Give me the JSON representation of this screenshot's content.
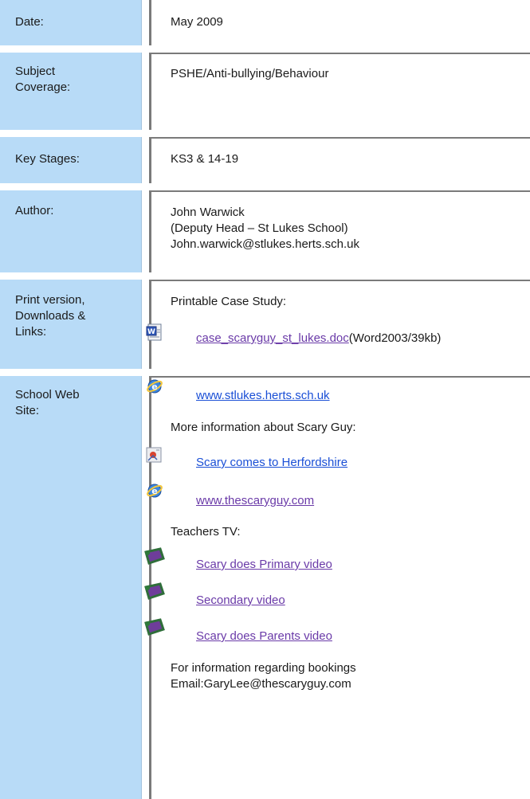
{
  "rows": {
    "date": {
      "label": "Date:",
      "value": "May 2009"
    },
    "subject": {
      "label": "Subject\nCoverage:",
      "value": "PSHE/Anti-bullying/Behaviour"
    },
    "key_stages": {
      "label": "Key Stages:",
      "value": "KS3 & 14-19"
    },
    "author": {
      "label": "Author:",
      "lines": "John Warwick\n(Deputy Head – St Lukes School)\nJohn.warwick@stlukes.herts.sch.uk"
    },
    "print": {
      "label": "Print version,\nDownloads &\nLinks:",
      "heading": "Printable Case Study:",
      "doc_link": "case_scaryguy_st_lukes.doc",
      "doc_meta": "(Word2003/39kb)",
      "doc_icon": "word-document-icon"
    },
    "website": {
      "label": "School Web\nSite:",
      "school_link": "www.stlukes.herts.sch.uk",
      "more_info": "More information about Scary Guy:",
      "scary_herts": "Scary comes to Herfordshire",
      "scary_site": "www.thescaryguy.com",
      "teachers_tv": "Teachers TV:",
      "video_primary": "Scary does Primary video",
      "video_secondary": "Secondary video",
      "video_parents": "Scary does Parents video",
      "booking_info": "For information regarding bookings\nEmail:GaryLee@thescaryguy.com",
      "icons": {
        "web": "internet-explorer-icon",
        "news": "news-article-icon",
        "video": "video-tv-icon"
      }
    }
  },
  "colors": {
    "label_bg": "#b8dbf7",
    "border": "#7a7a7a",
    "link_visited": "#6a3aa8",
    "link": "#1a4fd6"
  }
}
